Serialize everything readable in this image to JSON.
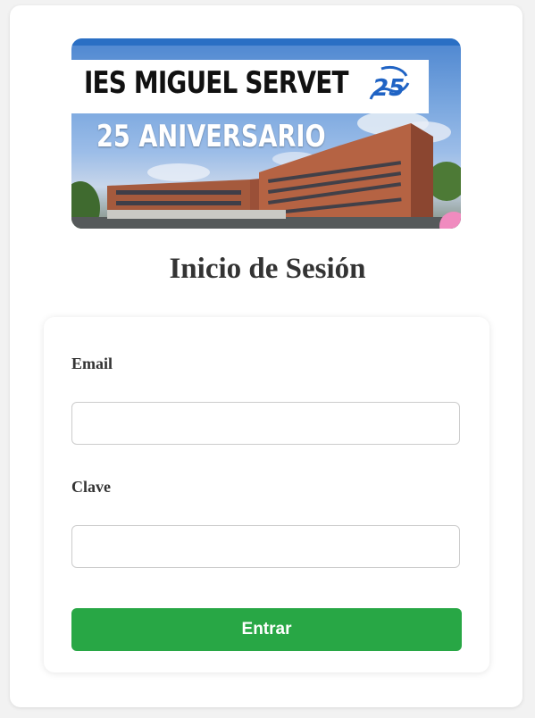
{
  "banner": {
    "title": "IES MIGUEL SERVET",
    "subtitle": "25 ANIVERSARIO",
    "logo_icon": "anniversary-25-logo-icon",
    "logo_text": "25"
  },
  "page": {
    "title": "Inicio de Sesión"
  },
  "form": {
    "email_label": "Email",
    "email_value": "",
    "password_label": "Clave",
    "password_value": "",
    "submit_label": "Entrar"
  },
  "colors": {
    "background": "#f2f2f2",
    "card": "#ffffff",
    "submit": "#28a745",
    "title_text": "#333333",
    "banner_blue": "#2a6fc4"
  }
}
